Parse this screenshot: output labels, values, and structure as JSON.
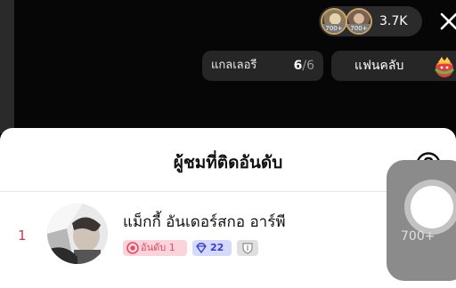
{
  "header": {
    "viewer_badge_1": "700+",
    "viewer_badge_2": "700+",
    "viewer_count": "3.7K",
    "close_icon": "close-icon"
  },
  "gallery": {
    "label": "แกลเลอรี",
    "current": "6",
    "total": "/6"
  },
  "fanclub": {
    "label": "แฟนคลับ",
    "emblem_icon": "fanclub-emblem-icon"
  },
  "sheet": {
    "title": "ผู้ชมที่ติดอันดับ",
    "help_icon": "question-circle-icon"
  },
  "ranking": [
    {
      "rank": "1",
      "name": "แม็กกี้ อันเดอร์สกอ อาร์พี",
      "rank_badge": "อันดับ 1",
      "diamond_level": "22"
    }
  ],
  "floating_button": {
    "label": "700+"
  },
  "colors": {
    "background": "#000000",
    "sheet": "#ffffff",
    "rank_red": "#c53a4e",
    "rank_badge_bg": "#fbd3da",
    "diamond_badge_bg": "#d4dafc",
    "diamond_text": "#3a3bd3"
  }
}
